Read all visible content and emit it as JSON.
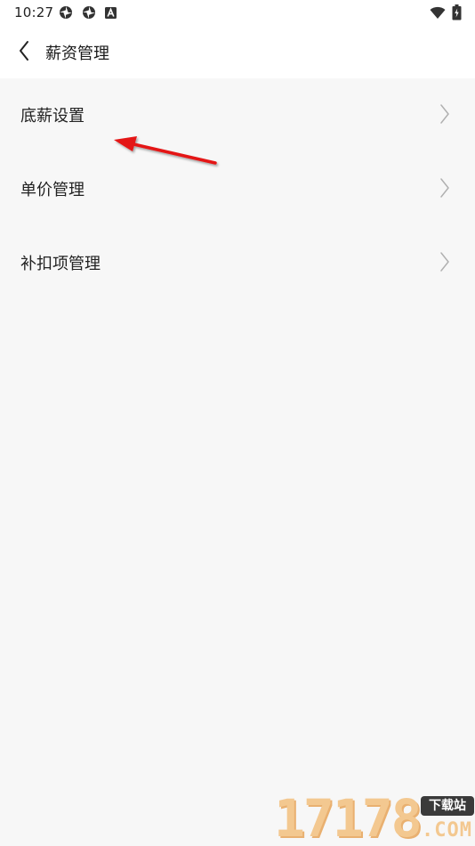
{
  "status_bar": {
    "time": "10:27",
    "left_icons": [
      "sync-icon",
      "sync-icon",
      "a-notification-icon"
    ],
    "right_icons": [
      "wifi-icon",
      "battery-charging-icon"
    ]
  },
  "header": {
    "back_icon": "chevron-left-icon",
    "title": "薪资管理"
  },
  "menu": {
    "items": [
      {
        "label": "底薪设置",
        "icon": "chevron-right-icon"
      },
      {
        "label": "单价管理",
        "icon": "chevron-right-icon"
      },
      {
        "label": "补扣项管理",
        "icon": "chevron-right-icon"
      }
    ]
  },
  "annotation": {
    "type": "arrow",
    "color": "#e41414",
    "points_to": "底薪设置"
  },
  "watermark": {
    "digits": "17178",
    "badge": "下载站",
    "suffix": ".COM"
  },
  "colors": {
    "background": "#f7f7f7",
    "header_background": "#ffffff",
    "text": "#222222",
    "chevron": "#b0b0b0",
    "watermark": "#f3c890"
  }
}
